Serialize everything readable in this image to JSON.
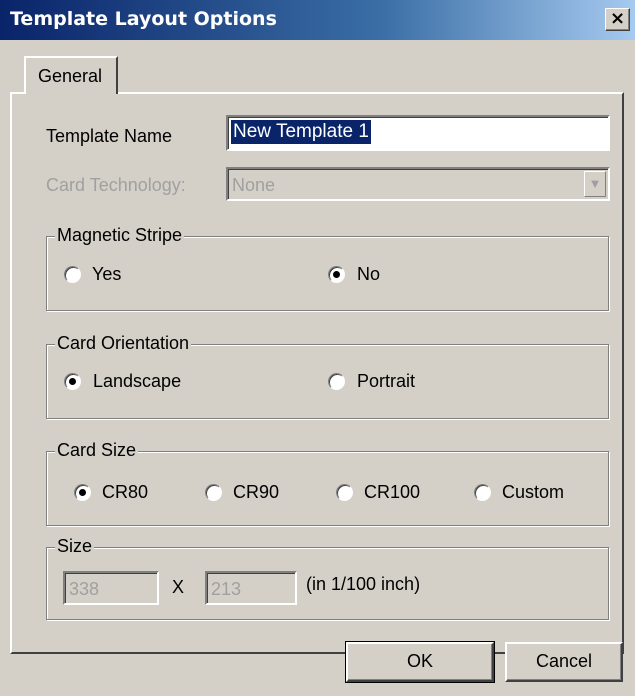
{
  "window": {
    "title": "Template Layout Options",
    "close_glyph": "×"
  },
  "tabs": [
    {
      "label": "General"
    }
  ],
  "fields": {
    "template_name_label": "Template Name",
    "template_name_value": "New Template 1",
    "card_technology_label": "Card Technology:",
    "card_technology_value": "None"
  },
  "groups": {
    "magnetic_stripe": {
      "title": "Magnetic Stripe",
      "options": [
        "Yes",
        "No"
      ],
      "selected": "No"
    },
    "card_orientation": {
      "title": "Card Orientation",
      "options": [
        "Landscape",
        "Portrait"
      ],
      "selected": "Landscape"
    },
    "card_size": {
      "title": "Card Size",
      "options": [
        "CR80",
        "CR90",
        "CR100",
        "Custom"
      ],
      "selected": "CR80"
    },
    "size": {
      "title": "Size",
      "width": "338",
      "separator": "X",
      "height": "213",
      "unit": "(in 1/100 inch)"
    }
  },
  "buttons": {
    "ok": "OK",
    "cancel": "Cancel"
  }
}
